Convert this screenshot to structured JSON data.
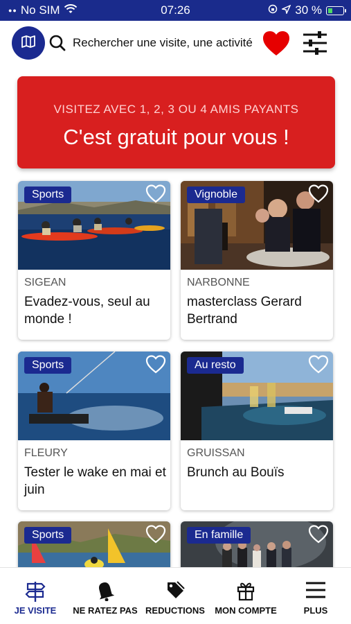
{
  "status_bar": {
    "carrier": "No SIM",
    "time": "07:26",
    "battery_percent": "30 %"
  },
  "header": {
    "search_placeholder": "Rechercher une visite, une activité",
    "icons": [
      "map-icon",
      "search-icon",
      "heart-icon",
      "filter-icon"
    ]
  },
  "banner": {
    "subtitle": "VISITEZ AVEC 1, 2, 3 OU 4 AMIS PAYANTS",
    "title": "C'est gratuit pour vous !",
    "color": "#d81f1f"
  },
  "cards": [
    {
      "tag": "Sports",
      "city": "SIGEAN",
      "title": "Evadez-vous, seul au monde !"
    },
    {
      "tag": "Vignoble",
      "city": "NARBONNE",
      "title": "masterclass Gerard Bertrand"
    },
    {
      "tag": "Sports",
      "city": "FLEURY",
      "title": "Tester le wake en mai et juin"
    },
    {
      "tag": "Au resto",
      "city": "GRUISSAN",
      "title": "Brunch au Bouïs"
    },
    {
      "tag": "Sports",
      "city": "",
      "title": ""
    },
    {
      "tag": "En famille",
      "city": "",
      "title": ""
    }
  ],
  "bottom_nav": [
    {
      "label": "JE VISITE",
      "icon": "signpost-icon",
      "active": true
    },
    {
      "label": "NE RATEZ PAS",
      "icon": "bell-icon",
      "active": false
    },
    {
      "label": "REDUCTIONS",
      "icon": "tag-icon",
      "active": false
    },
    {
      "label": "MON COMPTE",
      "icon": "gift-icon",
      "active": false
    },
    {
      "label": "PLUS",
      "icon": "menu-icon",
      "active": false
    }
  ],
  "colors": {
    "primary": "#1b2a90",
    "accent_red": "#d81f1f",
    "heart_red": "#e60000"
  }
}
